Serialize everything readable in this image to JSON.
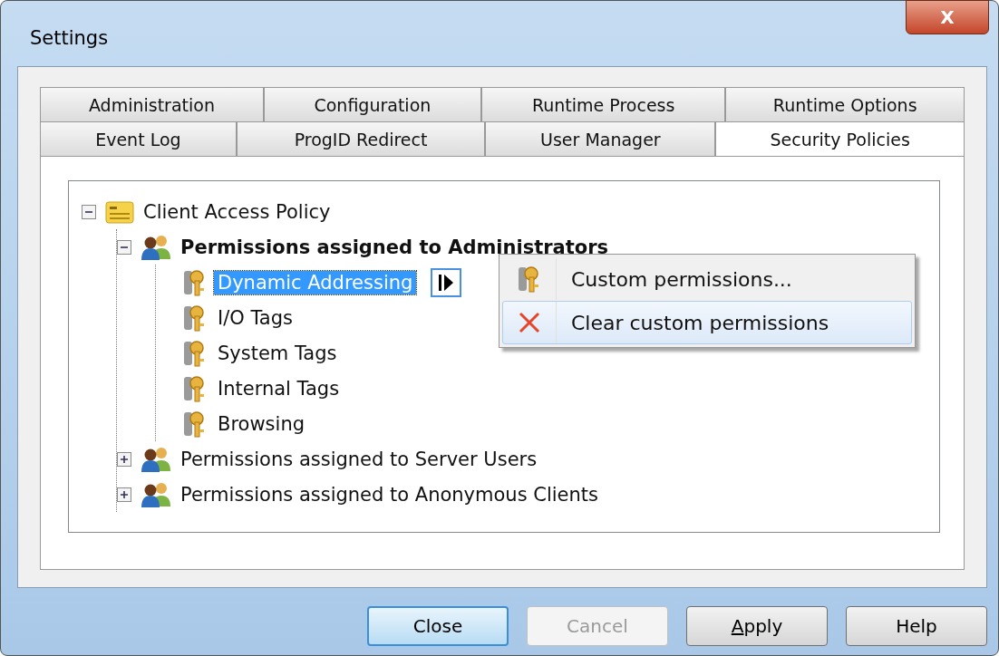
{
  "window": {
    "title": "Settings",
    "close_glyph": "X"
  },
  "tabs": [
    [
      {
        "label": "Administration",
        "selected": false
      },
      {
        "label": "Configuration",
        "selected": false
      },
      {
        "label": "Runtime Process",
        "selected": false
      },
      {
        "label": "Runtime Options",
        "selected": false
      }
    ],
    [
      {
        "label": "Event Log",
        "selected": false
      },
      {
        "label": "ProgID Redirect",
        "selected": false
      },
      {
        "label": "User Manager",
        "selected": false
      },
      {
        "label": "Security Policies",
        "selected": true
      }
    ]
  ],
  "tree": [
    {
      "label": "Client Access Policy",
      "kind": "policy",
      "bold": false,
      "expanded": true,
      "selected": false,
      "children": [
        {
          "label": "Permissions assigned to Administrators",
          "kind": "group",
          "bold": true,
          "expanded": true,
          "selected": false,
          "children": [
            {
              "label": "Dynamic Addressing",
              "kind": "permission",
              "bold": false,
              "selected": true
            },
            {
              "label": "I/O Tags",
              "kind": "permission",
              "bold": false,
              "selected": false
            },
            {
              "label": "System Tags",
              "kind": "permission",
              "bold": false,
              "selected": false
            },
            {
              "label": "Internal Tags",
              "kind": "permission",
              "bold": false,
              "selected": false
            },
            {
              "label": "Browsing",
              "kind": "permission",
              "bold": false,
              "selected": false
            }
          ]
        },
        {
          "label": "Permissions assigned to Server Users",
          "kind": "group",
          "bold": false,
          "expanded": false,
          "selected": false
        },
        {
          "label": "Permissions assigned to Anonymous Clients",
          "kind": "group",
          "bold": false,
          "expanded": false,
          "selected": false
        }
      ]
    }
  ],
  "context_menu": [
    {
      "label": "Custom permissions...",
      "kind": "custom",
      "highlighted": false
    },
    {
      "label": "Clear custom permissions",
      "kind": "clear",
      "highlighted": true
    }
  ],
  "buttons": [
    {
      "label": "Close",
      "default": true,
      "disabled": false,
      "mnemonic": false
    },
    {
      "label": "Cancel",
      "default": false,
      "disabled": true,
      "mnemonic": false
    },
    {
      "label": "Apply",
      "default": false,
      "disabled": false,
      "mnemonic": true
    },
    {
      "label": "Help",
      "default": false,
      "disabled": false,
      "mnemonic": false
    }
  ]
}
